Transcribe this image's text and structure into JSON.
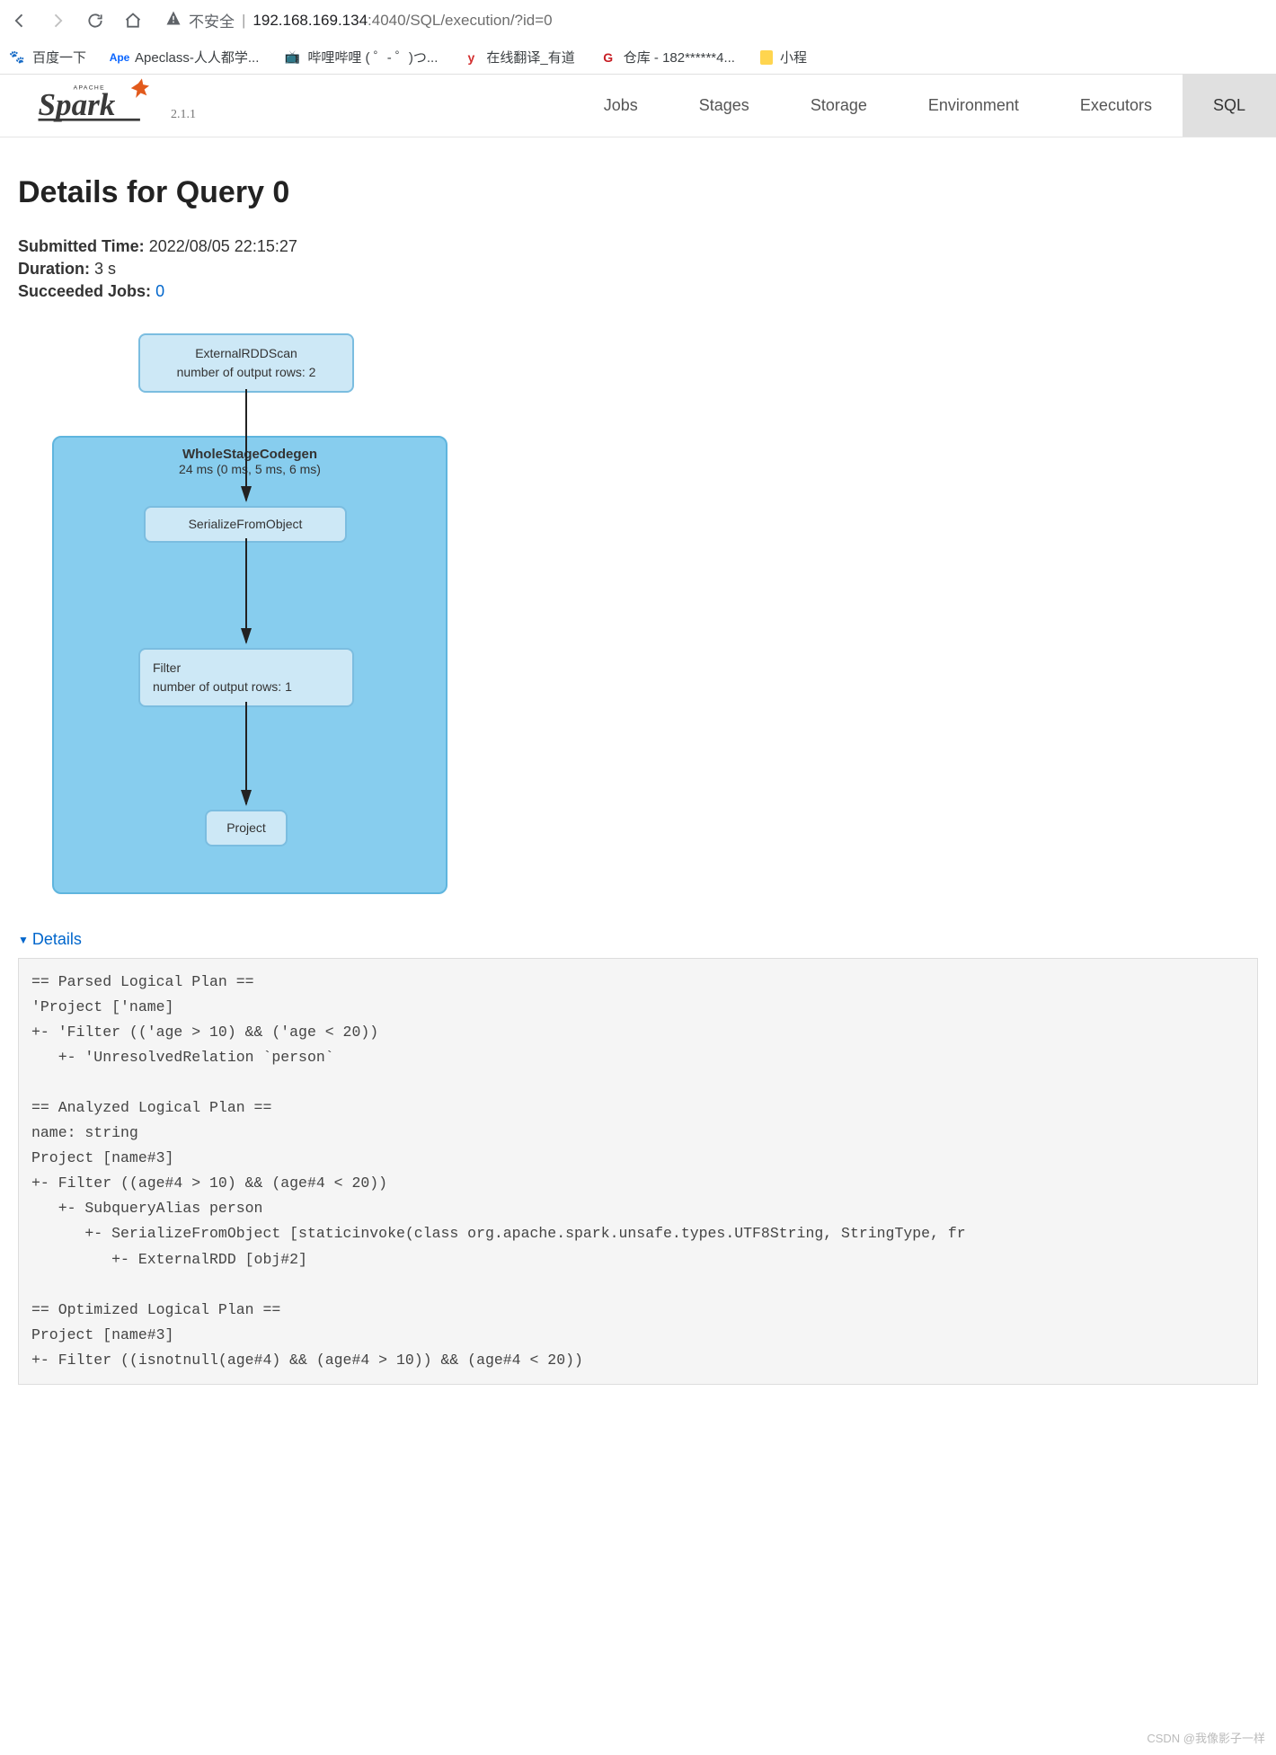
{
  "browser": {
    "insecure_label": "不安全",
    "url_host": "192.168.169.134",
    "url_port": ":4040",
    "url_path": "/SQL/execution/?id=0"
  },
  "bookmarks": [
    {
      "label": "百度一下"
    },
    {
      "label": "Apeclass-人人都学..."
    },
    {
      "label": "哔哩哔哩 (  ゜- ゜)つ..."
    },
    {
      "label": "在线翻译_有道"
    },
    {
      "label": "仓库 - 182******4..."
    },
    {
      "label": "小程"
    }
  ],
  "spark": {
    "version": "2.1.1",
    "tabs": [
      "Jobs",
      "Stages",
      "Storage",
      "Environment",
      "Executors",
      "SQL"
    ],
    "active_tab": "SQL"
  },
  "page": {
    "title": "Details for Query 0",
    "submitted_label": "Submitted Time:",
    "submitted_value": "2022/08/05 22:15:27",
    "duration_label": "Duration:",
    "duration_value": "3 s",
    "succeeded_label": "Succeeded Jobs:",
    "succeeded_link": "0"
  },
  "dag": {
    "node_external": {
      "title": "ExternalRDDScan",
      "detail": "number of output rows: 2"
    },
    "stage": {
      "title": "WholeStageCodegen",
      "sub": "24 ms (0 ms, 5 ms, 6 ms)"
    },
    "node_serialize": {
      "title": "SerializeFromObject"
    },
    "node_filter": {
      "title": "Filter",
      "detail": "number of output rows: 1"
    },
    "node_project": {
      "title": "Project"
    }
  },
  "details": {
    "toggle": "Details",
    "plan": "== Parsed Logical Plan ==\n'Project ['name]\n+- 'Filter (('age > 10) && ('age < 20))\n   +- 'UnresolvedRelation `person`\n\n== Analyzed Logical Plan ==\nname: string\nProject [name#3]\n+- Filter ((age#4 > 10) && (age#4 < 20))\n   +- SubqueryAlias person\n      +- SerializeFromObject [staticinvoke(class org.apache.spark.unsafe.types.UTF8String, StringType, fr\n         +- ExternalRDD [obj#2]\n\n== Optimized Logical Plan ==\nProject [name#3]\n+- Filter ((isnotnull(age#4) && (age#4 > 10)) && (age#4 < 20))"
  },
  "watermark": "CSDN @我像影子一样"
}
